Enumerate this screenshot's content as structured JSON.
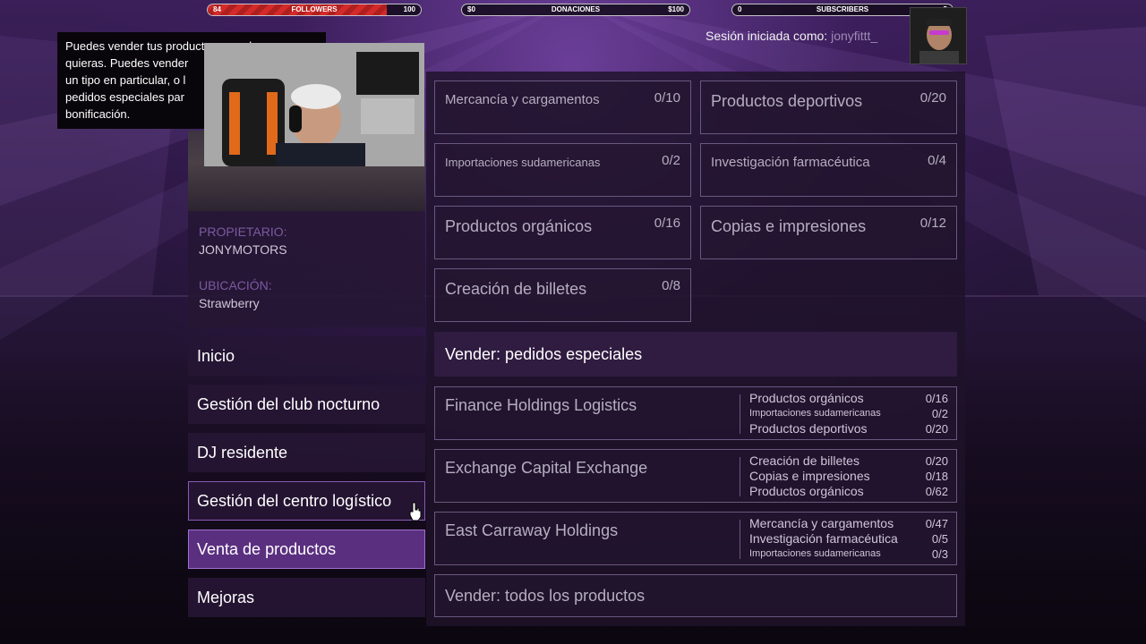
{
  "stream_bars": {
    "followers": {
      "left": "84",
      "label": "FOLLOWERS",
      "right": "100",
      "progress": 0.84
    },
    "donations": {
      "left": "$0",
      "label": "DONACIONES",
      "right": "$100"
    },
    "subscribers": {
      "left": "0",
      "label": "SUBSCRIBERS",
      "right": "5"
    }
  },
  "session": {
    "label": "Sesión iniciada como:",
    "username": "jonyfittt_"
  },
  "tooltip": {
    "line1": "Puedes vender tus productos cuando",
    "line2": "quieras. Puedes vender",
    "line3": "un tipo en particular, o l",
    "line4": "pedidos especiales par",
    "line5": "bonificación."
  },
  "info": {
    "owner_label": "PROPIETARIO:",
    "owner_value": "JONYMOTORS",
    "location_label": "UBICACIÓN:",
    "location_value": "Strawberry"
  },
  "menu": {
    "items": [
      {
        "label": "Inicio"
      },
      {
        "label": "Gestión del club nocturno"
      },
      {
        "label": "DJ residente"
      },
      {
        "label": "Gestión del centro logístico"
      },
      {
        "label": "Venta de productos"
      },
      {
        "label": "Mejoras"
      }
    ]
  },
  "products": [
    {
      "name": "Mercancía y cargamentos",
      "count": "0/10"
    },
    {
      "name": "Productos deportivos",
      "count": "0/20"
    },
    {
      "name": "Importaciones sudamericanas",
      "count": "0/2"
    },
    {
      "name": "Investigación farmacéutica",
      "count": "0/4"
    },
    {
      "name": "Productos orgánicos",
      "count": "0/16"
    },
    {
      "name": "Copias e impresiones",
      "count": "0/12"
    },
    {
      "name": "Creación de billetes",
      "count": "0/8"
    }
  ],
  "special_orders": {
    "header": "Vender: pedidos especiales",
    "orders": [
      {
        "name": "Finance Holdings Logistics",
        "items": [
          {
            "name": "Productos orgánicos",
            "count": "0/16"
          },
          {
            "name": "Importaciones sudamericanas",
            "count": "0/2"
          },
          {
            "name": "Productos deportivos",
            "count": "0/20"
          }
        ]
      },
      {
        "name": "Exchange Capital Exchange",
        "items": [
          {
            "name": "Creación de billetes",
            "count": "0/20"
          },
          {
            "name": "Copias e impresiones",
            "count": "0/18"
          },
          {
            "name": "Productos orgánicos",
            "count": "0/62"
          }
        ]
      },
      {
        "name": "East Carraway Holdings",
        "items": [
          {
            "name": "Mercancía y cargamentos",
            "count": "0/47"
          },
          {
            "name": "Investigación farmacéutica",
            "count": "0/5"
          },
          {
            "name": "Importaciones sudamericanas",
            "count": "0/3"
          }
        ]
      }
    ]
  },
  "sell_all": "Vender: todos los productos"
}
